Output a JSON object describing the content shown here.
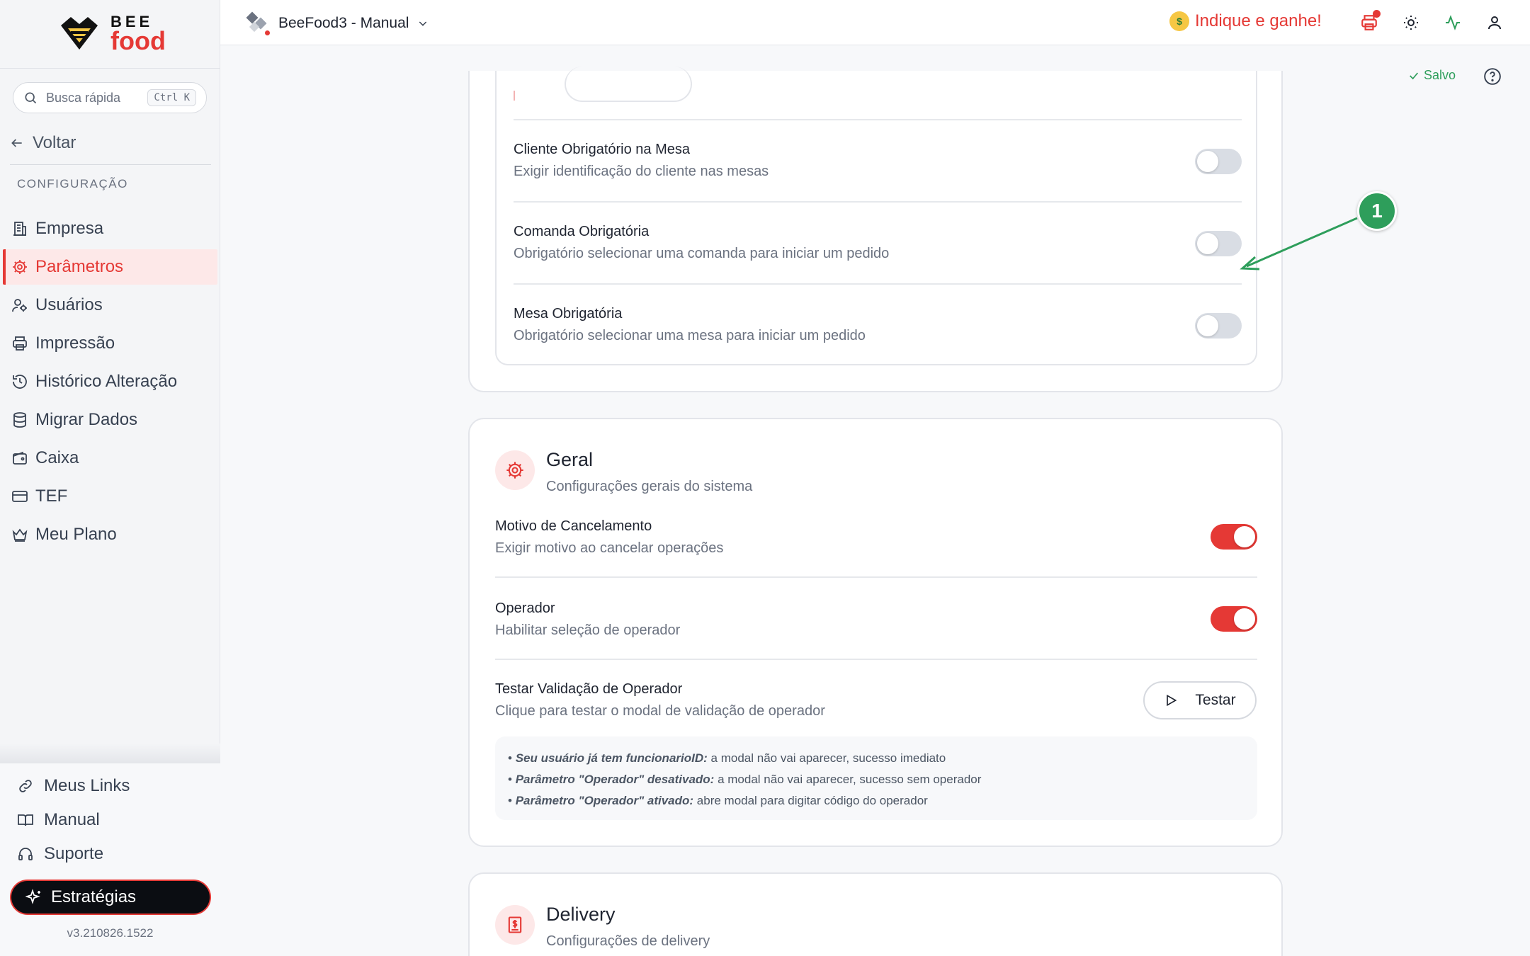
{
  "sidebar": {
    "logo_top": "BEE",
    "logo_bottom": "food",
    "search_placeholder": "Busca rápida",
    "search_shortcut": "Ctrl K",
    "back_label": "Voltar",
    "section_label": "CONFIGURAÇÃO",
    "items": [
      {
        "label": "Empresa",
        "icon": "building-icon"
      },
      {
        "label": "Parâmetros",
        "icon": "gear-icon",
        "active": true
      },
      {
        "label": "Usuários",
        "icon": "users-icon"
      },
      {
        "label": "Impressão",
        "icon": "printer-icon"
      },
      {
        "label": "Histórico Alteração",
        "icon": "history-icon"
      },
      {
        "label": "Migrar Dados",
        "icon": "database-icon"
      },
      {
        "label": "Caixa",
        "icon": "wallet-icon"
      },
      {
        "label": "TEF",
        "icon": "card-icon"
      },
      {
        "label": "Meu Plano",
        "icon": "crown-icon"
      }
    ],
    "bottom_links": [
      {
        "label": "Meus Links",
        "icon": "link-icon"
      },
      {
        "label": "Manual",
        "icon": "book-icon"
      },
      {
        "label": "Suporte",
        "icon": "headset-icon"
      }
    ],
    "strategies_label": "Estratégias",
    "version": "v3.210826.1522"
  },
  "topbar": {
    "store_name": "BeeFood3 - Manual",
    "refer_label": "Indique e ganhe!"
  },
  "status": {
    "saved_label": "Salvo"
  },
  "mesas": {
    "rows": [
      {
        "title": "Cliente Obrigatório na Mesa",
        "subtitle": "Exigir identificação do cliente nas mesas",
        "enabled": false
      },
      {
        "title": "Comanda Obrigatória",
        "subtitle": "Obrigatório selecionar uma comanda para iniciar um pedido",
        "enabled": false
      },
      {
        "title": "Mesa Obrigatória",
        "subtitle": "Obrigatório selecionar uma mesa para iniciar um pedido",
        "enabled": false
      }
    ]
  },
  "geral": {
    "title": "Geral",
    "subtitle": "Configurações gerais do sistema",
    "rows": [
      {
        "title": "Motivo de Cancelamento",
        "subtitle": "Exigir motivo ao cancelar operações",
        "enabled": true
      },
      {
        "title": "Operador",
        "subtitle": "Habilitar seleção de operador",
        "enabled": true
      }
    ],
    "test": {
      "title": "Testar Validação de Operador",
      "subtitle": "Clique para testar o modal de validação de operador",
      "button_label": "Testar"
    },
    "info": [
      {
        "bold": "Seu usuário já tem funcionarioID:",
        "text": "a modal não vai aparecer, sucesso imediato"
      },
      {
        "bold": "Parâmetro \"Operador\" desativado:",
        "text": "a modal não vai aparecer, sucesso sem operador"
      },
      {
        "bold": "Parâmetro \"Operador\" ativado:",
        "text": "abre modal para digitar código do operador"
      }
    ]
  },
  "delivery": {
    "title": "Delivery",
    "subtitle": "Configurações de delivery"
  },
  "annotation": {
    "badge": "1"
  },
  "colors": {
    "accent": "#e53935",
    "success": "#2e9e5b",
    "toggle_off": "#d9dde4"
  }
}
